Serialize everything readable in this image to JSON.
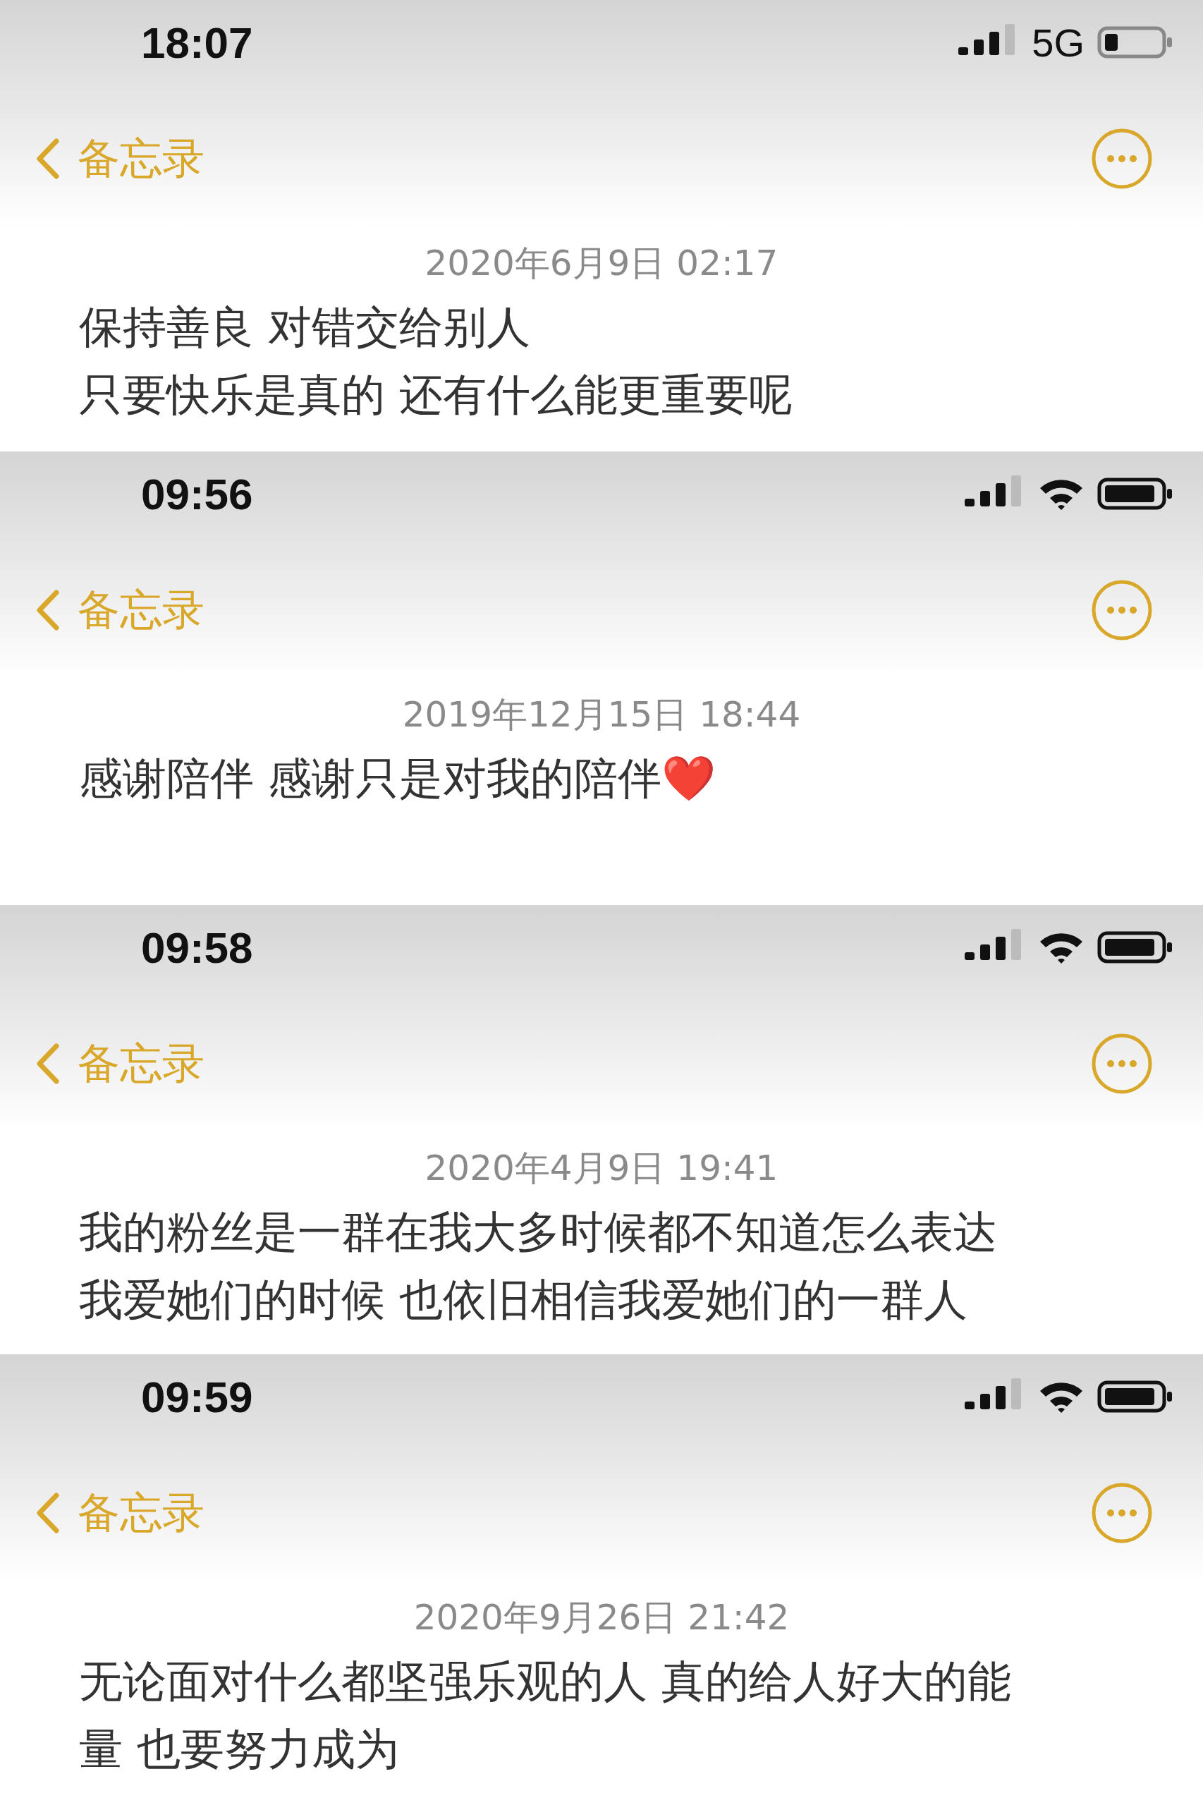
{
  "screens": [
    {
      "status_bar": {
        "time": "18:07",
        "network": {
          "kind": "cellular",
          "label": "5G"
        }
      },
      "nav": {
        "back_label": "备忘录"
      },
      "note": {
        "date": "2020年6月9日 02:17",
        "lines": [
          "保持善良 对错交给别人",
          "只要快乐是真的 还有什么能更重要呢"
        ]
      }
    },
    {
      "status_bar": {
        "time": "09:56",
        "network": {
          "kind": "wifi"
        }
      },
      "nav": {
        "back_label": "备忘录"
      },
      "note": {
        "date": "2019年12月15日 18:44",
        "lines": [
          "感谢陪伴 感谢只是对我的陪伴❤️"
        ]
      }
    },
    {
      "status_bar": {
        "time": "09:58",
        "network": {
          "kind": "wifi"
        }
      },
      "nav": {
        "back_label": "备忘录"
      },
      "note": {
        "date": "2020年4月9日 19:41",
        "lines": [
          "我的粉丝是一群在我大多时候都不知道怎么表达",
          "我爱她们的时候 也依旧相信我爱她们的一群人"
        ]
      }
    },
    {
      "status_bar": {
        "time": "09:59",
        "network": {
          "kind": "wifi"
        }
      },
      "nav": {
        "back_label": "备忘录"
      },
      "note": {
        "date": "2020年9月26日 21:42",
        "lines": [
          "无论面对什么都坚强乐观的人 真的给人好大的能",
          "量  也要努力成为"
        ]
      }
    }
  ]
}
